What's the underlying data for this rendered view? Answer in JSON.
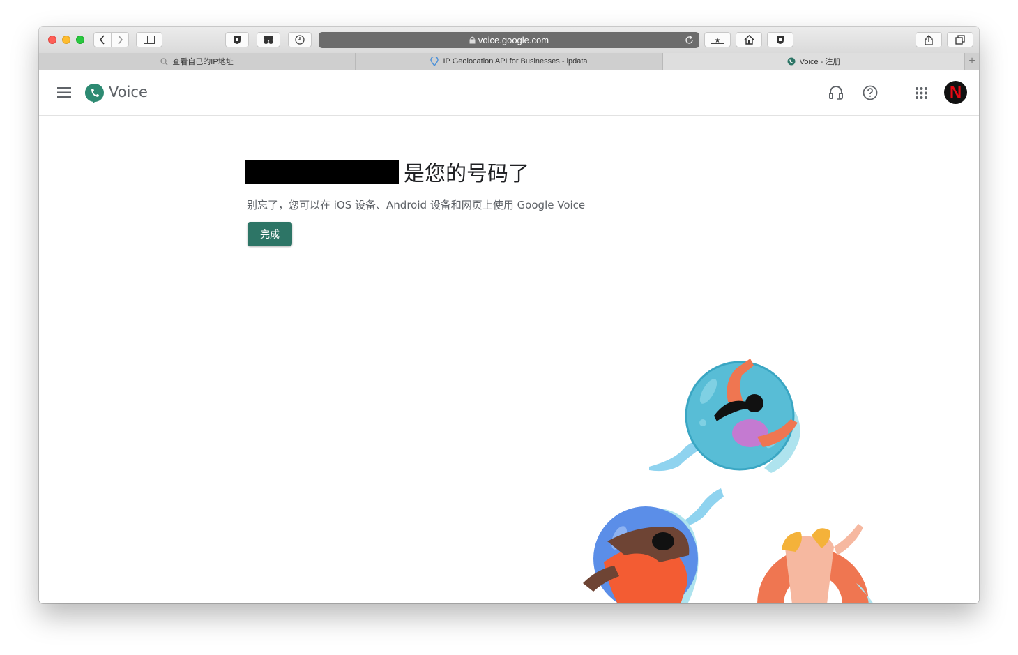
{
  "browser": {
    "url": "voice.google.com",
    "tabs": [
      {
        "label": "查看自己的IP地址",
        "active": false
      },
      {
        "label": "IP Geolocation API for Businesses - ipdata",
        "active": false
      },
      {
        "label": "Voice - 注册",
        "active": true
      }
    ],
    "new_tab_symbol": "+"
  },
  "app": {
    "name": "Voice",
    "brand_color": "#2d7566"
  },
  "main": {
    "headline": "是您的号码了",
    "subtext": "别忘了，您可以在 iOS 设备、Android 设备和网页上使用 Google Voice",
    "done_button": "完成"
  },
  "avatar_letter": "N"
}
